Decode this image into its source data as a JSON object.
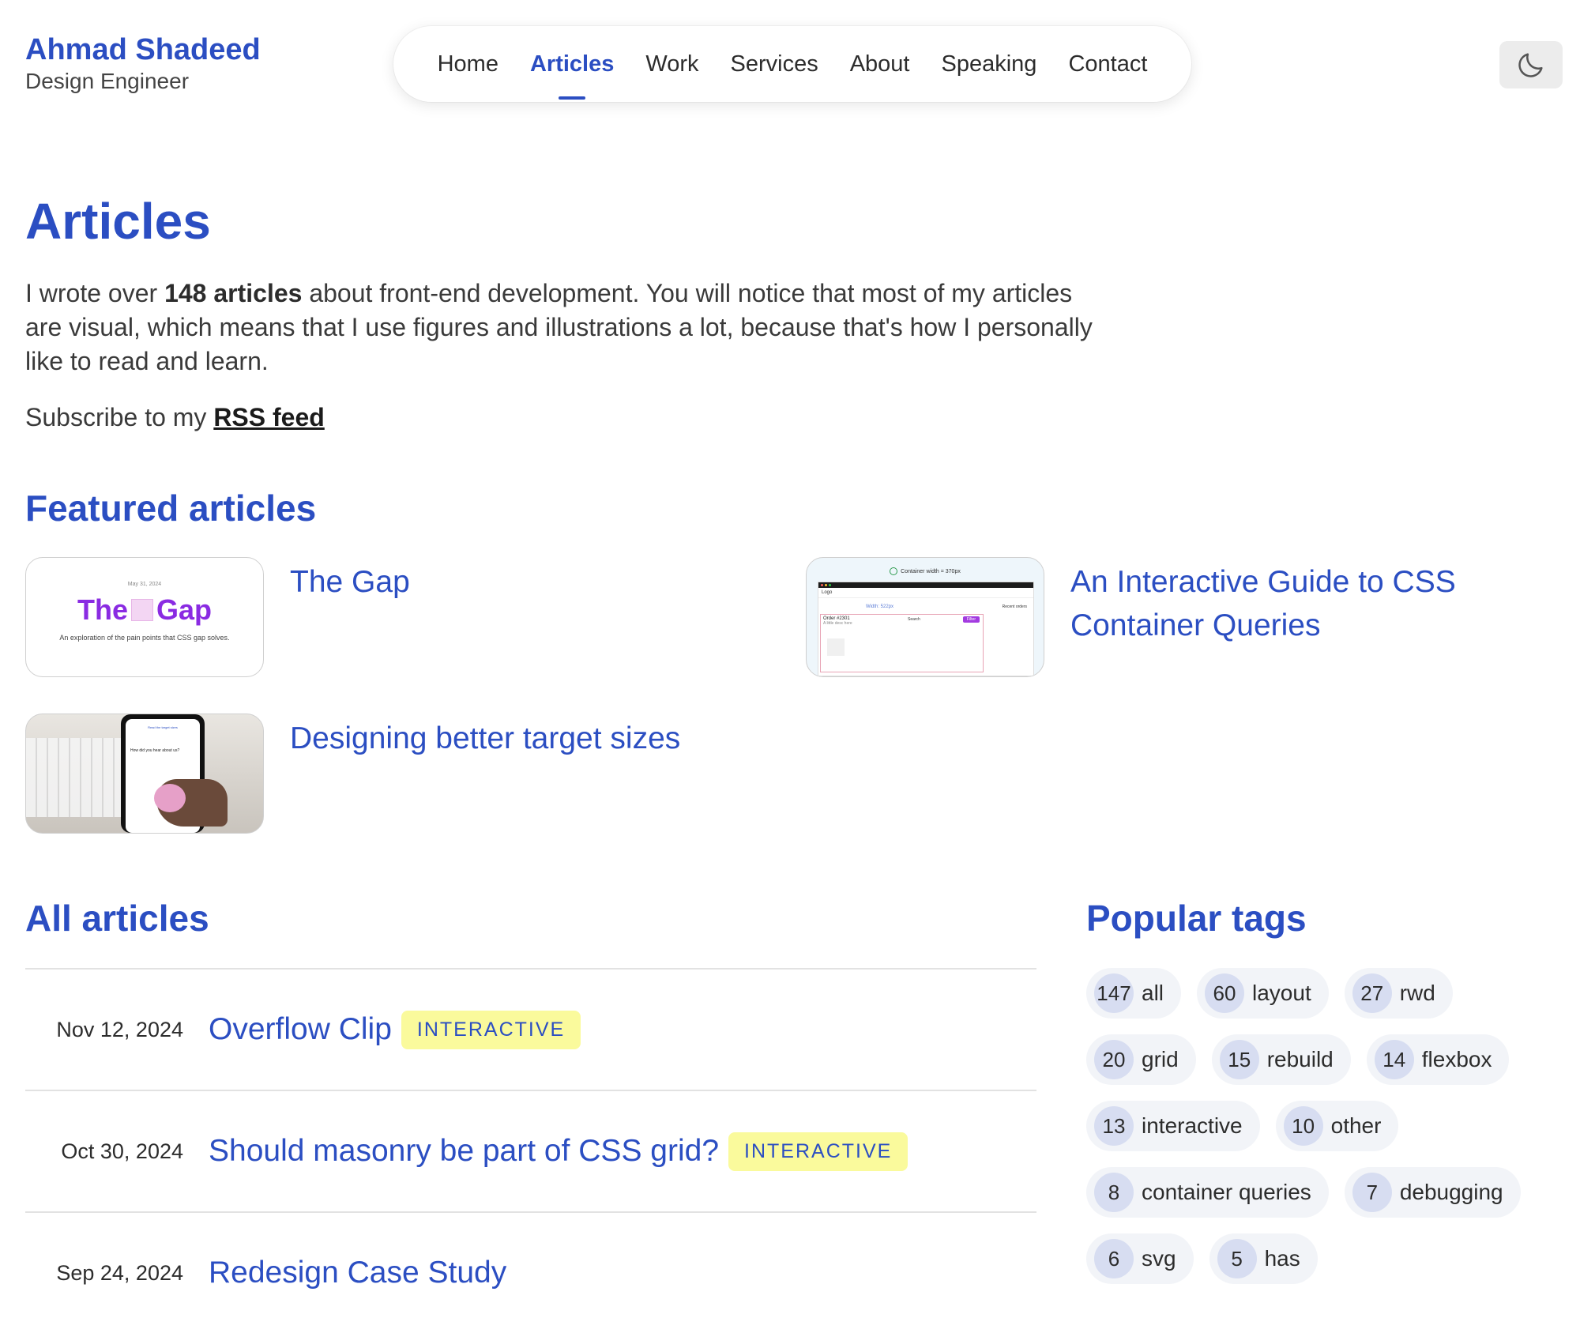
{
  "header": {
    "brand_name": "Ahmad Shadeed",
    "brand_role": "Design Engineer",
    "nav": [
      {
        "label": "Home",
        "active": false
      },
      {
        "label": "Articles",
        "active": true
      },
      {
        "label": "Work",
        "active": false
      },
      {
        "label": "Services",
        "active": false
      },
      {
        "label": "About",
        "active": false
      },
      {
        "label": "Speaking",
        "active": false
      },
      {
        "label": "Contact",
        "active": false
      }
    ],
    "theme_icon": "moon-icon"
  },
  "intro": {
    "title": "Articles",
    "text_before": "I wrote over ",
    "text_bold": "148 articles",
    "text_after": " about front-end development. You will notice that most of my articles are visual, which means that I use figures and illustrations a lot, because that's how I personally like to read and learn.",
    "subscribe_text": "Subscribe to my ",
    "rss_label": "RSS feed"
  },
  "featured": {
    "heading": "Featured articles",
    "items": [
      {
        "title": "The Gap",
        "thumb": {
          "date": "May 31, 2024",
          "word_left": "The",
          "word_right": "Gap",
          "caption": "An exploration of the pain points that CSS gap solves."
        }
      },
      {
        "title": "An Interactive Guide to CSS Container Queries",
        "thumb": {
          "container_label": "Container width = 370px",
          "logo": "Logo",
          "width_label": "Width: 522px",
          "recent": "Recent orders",
          "order": "Order #2301",
          "order_sub": "A little desc here",
          "search": "Search",
          "filter": "Filter"
        }
      },
      {
        "title": "Designing better target sizes",
        "thumb": {
          "top": "Read the target sizes",
          "question": "How did you hear about us?"
        }
      }
    ]
  },
  "all_articles": {
    "heading": "All articles",
    "items": [
      {
        "date": "Nov 12, 2024",
        "title": "Overflow Clip",
        "badge": "INTERACTIVE"
      },
      {
        "date": "Oct 30, 2024",
        "title": "Should masonry be part of CSS grid?",
        "badge": "INTERACTIVE"
      },
      {
        "date": "Sep 24, 2024",
        "title": "Redesign Case Study",
        "badge": ""
      }
    ]
  },
  "popular_tags": {
    "heading": "Popular tags",
    "items": [
      {
        "count": "147",
        "name": "all"
      },
      {
        "count": "60",
        "name": "layout"
      },
      {
        "count": "27",
        "name": "rwd"
      },
      {
        "count": "20",
        "name": "grid"
      },
      {
        "count": "15",
        "name": "rebuild"
      },
      {
        "count": "14",
        "name": "flexbox"
      },
      {
        "count": "13",
        "name": "interactive"
      },
      {
        "count": "10",
        "name": "other"
      },
      {
        "count": "8",
        "name": "container queries"
      },
      {
        "count": "7",
        "name": "debugging"
      },
      {
        "count": "6",
        "name": "svg"
      },
      {
        "count": "5",
        "name": "has"
      }
    ]
  }
}
